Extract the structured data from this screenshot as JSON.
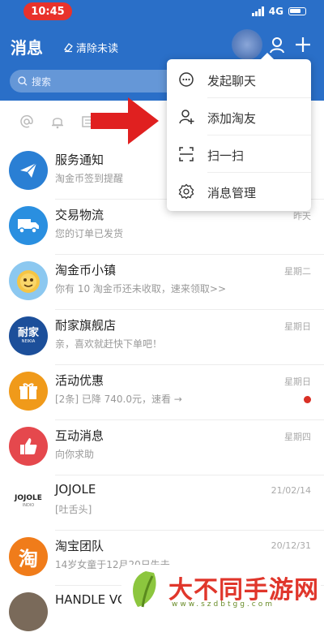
{
  "status_bar": {
    "time": "10:45",
    "network": "4G"
  },
  "header": {
    "title": "消息",
    "clear_unread": "清除未读",
    "search_placeholder": "搜索"
  },
  "menu": {
    "items": [
      {
        "label": "发起聊天",
        "icon": "chat-bubble-icon"
      },
      {
        "label": "添加淘友",
        "icon": "add-friend-icon"
      },
      {
        "label": "扫一扫",
        "icon": "scan-icon"
      },
      {
        "label": "消息管理",
        "icon": "settings-gear-icon"
      }
    ]
  },
  "messages": [
    {
      "title": "服务通知",
      "subtitle": "淘金币签到提醒",
      "time": "",
      "avatar_color": "#2a7fd4",
      "avatar_icon": "paper-plane-icon"
    },
    {
      "title": "交易物流",
      "subtitle": "您的订单已发货",
      "time": "昨天",
      "avatar_color": "#2a8fe0",
      "avatar_icon": "truck-icon"
    },
    {
      "title": "淘金币小镇",
      "subtitle": "你有 10 淘金币还未收取，速来领取>>",
      "time": "星期二",
      "avatar_color": "#8cc8f0",
      "avatar_icon": "coin-character-icon"
    },
    {
      "title": "耐家旗舰店",
      "subtitle": "亲，喜欢就赶快下单吧！",
      "time": "星期日",
      "avatar_color": "#1c4f9a",
      "avatar_text": "耐家",
      "avatar_sub": "NEIKIA"
    },
    {
      "title": "活动优惠",
      "subtitle": "[2条] 已降 740.0元，速看 →",
      "time": "星期日",
      "avatar_color": "#f09a1a",
      "avatar_icon": "gift-icon",
      "unread": true
    },
    {
      "title": "互动消息",
      "subtitle": "向你求助",
      "time": "星期四",
      "avatar_color": "#e5484d",
      "avatar_icon": "thumbs-up-icon"
    },
    {
      "title": "JOJOLE",
      "subtitle": "[吐舌头]",
      "time": "21/02/14",
      "avatar_color": "#ffffff",
      "avatar_text": "JOJOLE",
      "avatar_sub": "INDIO"
    },
    {
      "title": "淘宝团队",
      "subtitle": "14岁女童于12月20日失去…",
      "time": "20/12/31",
      "avatar_color": "#f07c1a",
      "avatar_text": "淘"
    },
    {
      "title": "HANDLE VO",
      "subtitle": "",
      "time": "",
      "avatar_color": "#7a6a5a"
    }
  ],
  "watermark": {
    "text": "大不同手游网",
    "url": "www.szdbtgg.com"
  },
  "colors": {
    "header": "#2a6fc8",
    "arrow": "#e02020",
    "unread_dot": "#d93025"
  }
}
